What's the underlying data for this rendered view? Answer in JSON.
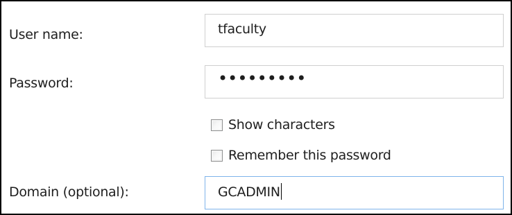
{
  "form": {
    "username": {
      "label": "User name:",
      "value": "tfaculty"
    },
    "password": {
      "label": "Password:",
      "masked_value": "•••••••••"
    },
    "show_characters": {
      "label": "Show characters",
      "checked": false
    },
    "remember_password": {
      "label": "Remember this password",
      "checked": false
    },
    "domain": {
      "label": "Domain (optional):",
      "value": "GCADMIN",
      "focused": true
    }
  },
  "colors": {
    "focus_border": "#7eb4ea",
    "field_border": "#cfcfcf",
    "frame_border": "#000000"
  }
}
